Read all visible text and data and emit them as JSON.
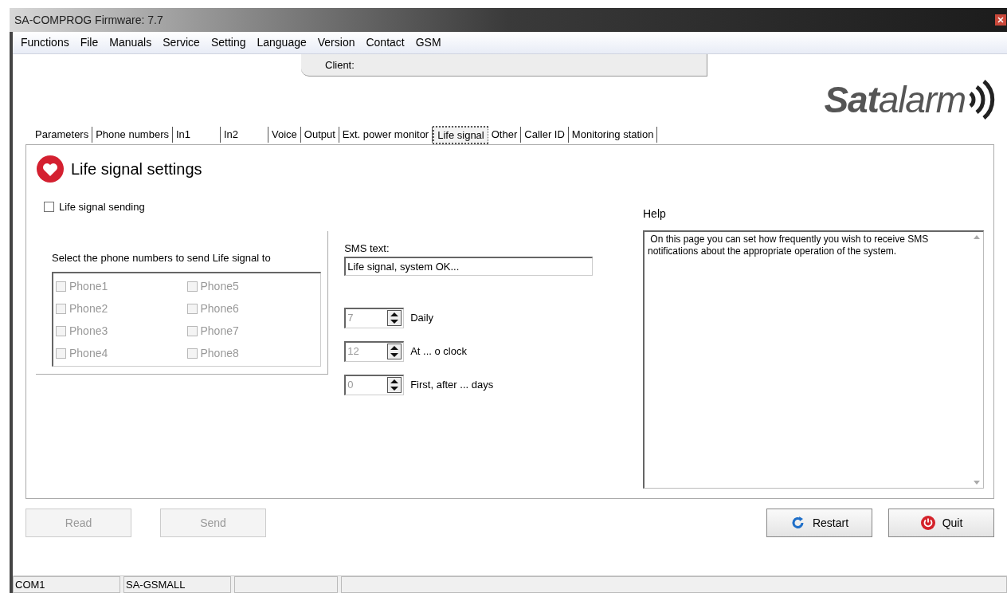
{
  "window": {
    "title": "SA-COMPROG Firmware: 7.7"
  },
  "menu": [
    "Functions",
    "File",
    "Manuals",
    "Service",
    "Setting",
    "Language",
    "Version",
    "Contact",
    "GSM"
  ],
  "client": {
    "label": "Client:"
  },
  "logo": {
    "text": "**Sat**alarm"
  },
  "tabs": [
    {
      "label": "Parameters",
      "selected": false
    },
    {
      "label": "Phone numbers",
      "selected": false
    },
    {
      "label": "In1",
      "selected": false
    },
    {
      "label": "In2",
      "selected": false
    },
    {
      "label": "Voice",
      "selected": false
    },
    {
      "label": "Output",
      "selected": false
    },
    {
      "label": "Ext. power monitor",
      "selected": false
    },
    {
      "label": "Life signal",
      "selected": true
    },
    {
      "label": "Other",
      "selected": false
    },
    {
      "label": "Caller ID",
      "selected": false
    },
    {
      "label": "Monitoring station",
      "selected": false
    }
  ],
  "page": {
    "title": "Life signal settings",
    "sending": {
      "label": "Life signal sending",
      "checked": false
    },
    "phones_title": "Select the phone numbers to send Life signal to",
    "phones": [
      {
        "label": "Phone1",
        "checked": false,
        "disabled": true
      },
      {
        "label": "Phone2",
        "checked": false,
        "disabled": true
      },
      {
        "label": "Phone3",
        "checked": false,
        "disabled": true
      },
      {
        "label": "Phone4",
        "checked": false,
        "disabled": true
      },
      {
        "label": "Phone5",
        "checked": false,
        "disabled": true
      },
      {
        "label": "Phone6",
        "checked": false,
        "disabled": true
      },
      {
        "label": "Phone7",
        "checked": false,
        "disabled": true
      },
      {
        "label": "Phone8",
        "checked": false,
        "disabled": true
      }
    ],
    "sms_label": "SMS text:",
    "sms_value": "Life signal, system OK...",
    "spinners": [
      {
        "value": "7",
        "label": "Daily",
        "disabled": true
      },
      {
        "value": "12",
        "label": "At ... o clock",
        "disabled": true
      },
      {
        "value": "0",
        "label": "First, after ... days",
        "disabled": true
      }
    ],
    "help": {
      "label": "Help",
      "text": " On this page you can set how frequently you wish to receive SMS notifications about the appropriate operation of the system."
    }
  },
  "buttons": [
    {
      "label": "Read",
      "kind": "plain",
      "disabled": true
    },
    {
      "label": "Send",
      "kind": "plain",
      "disabled": true
    },
    {
      "label": "Restart",
      "kind": "restart",
      "disabled": false
    },
    {
      "label": "Quit",
      "kind": "quit",
      "disabled": false
    }
  ],
  "status_bar": [
    "COM1",
    "SA-GSMALL"
  ]
}
